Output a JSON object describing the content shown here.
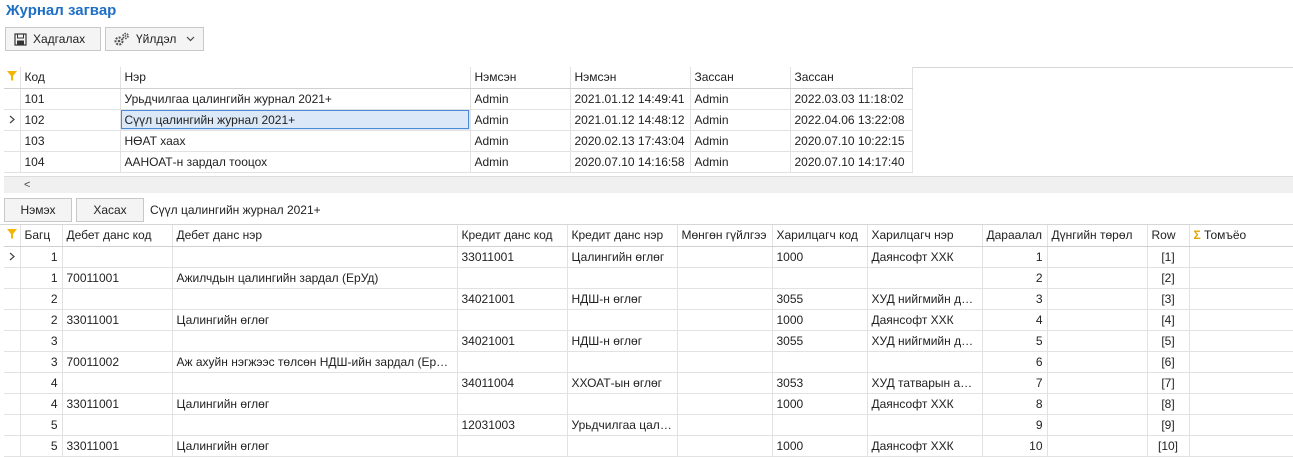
{
  "title": "Журнал загвар",
  "toolbar": {
    "save_label": "Хадгалах",
    "action_label": "Үйлдэл"
  },
  "master": {
    "columns": [
      "Код",
      "Нэр",
      "Нэмсэн",
      "Нэмсэн",
      "Зассан",
      "Зассан"
    ],
    "rows": [
      [
        "101",
        "Урьдчилгаа цалингийн журнал 2021+",
        "Admin",
        "2021.01.12 14:49:41",
        "Admin",
        "2022.03.03 11:18:02"
      ],
      [
        "102",
        "Сүүл цалингийн журнал 2021+",
        "Admin",
        "2021.01.12 14:48:12",
        "Admin",
        "2022.04.06 13:22:08"
      ],
      [
        "103",
        "НӨАТ хаах",
        "Admin",
        "2020.02.13 17:43:04",
        "Admin",
        "2020.07.10 10:22:15"
      ],
      [
        "104",
        "ААНОАТ-н зардал тооцох",
        "Admin",
        "2020.07.10 14:16:58",
        "Admin",
        "2020.07.10 14:17:40"
      ]
    ],
    "scroll_left": "<"
  },
  "detail_bar": {
    "add_label": "Нэмэх",
    "remove_label": "Хасах",
    "current_name": "Сүүл цалингийн журнал 2021+"
  },
  "detail": {
    "columns": [
      "Багц",
      "Дебет данс код",
      "Дебет данс нэр",
      "Кредит данс код",
      "Кредит данс нэр",
      "Мөнгөн гүйлгээ",
      "Харилцагч код",
      "Харилцагч нэр",
      "Дараалал",
      "Дүнгийн төрөл",
      "Row",
      "Томъёо"
    ],
    "rows": [
      [
        "1",
        "",
        "",
        "33011001",
        "Цалингийн өглөг",
        "",
        "1000",
        "Даянсофт ХХК",
        "1",
        "",
        "[1]",
        ""
      ],
      [
        "1",
        "70011001",
        "Ажилчдын цалингийн зардал (ЕрУд)",
        "",
        "",
        "",
        "",
        "",
        "2",
        "",
        "[2]",
        ""
      ],
      [
        "2",
        "",
        "",
        "34021001",
        "НДШ-н өглөг",
        "",
        "3055",
        "ХУД нийгмийн да...",
        "3",
        "",
        "[3]",
        ""
      ],
      [
        "2",
        "33011001",
        "Цалингийн өглөг",
        "",
        "",
        "",
        "1000",
        "Даянсофт ХХК",
        "4",
        "",
        "[4]",
        ""
      ],
      [
        "3",
        "",
        "",
        "34021001",
        "НДШ-н өглөг",
        "",
        "3055",
        "ХУД нийгмийн да...",
        "5",
        "",
        "[5]",
        ""
      ],
      [
        "3",
        "70011002",
        "Аж ахуйн нэгжээс төлсөн НДШ-ийн зардал (ЕрУд)",
        "",
        "",
        "",
        "",
        "",
        "6",
        "",
        "[6]",
        ""
      ],
      [
        "4",
        "",
        "",
        "34011004",
        "ХХОАТ-ын өглөг",
        "",
        "3053",
        "ХУД татварын алба",
        "7",
        "",
        "[7]",
        ""
      ],
      [
        "4",
        "33011001",
        "Цалингийн өглөг",
        "",
        "",
        "",
        "1000",
        "Даянсофт ХХК",
        "8",
        "",
        "[8]",
        ""
      ],
      [
        "5",
        "",
        "",
        "12031003",
        "Урьдчилгаа цалин",
        "",
        "",
        "",
        "9",
        "",
        "[9]",
        ""
      ],
      [
        "5",
        "33011001",
        "Цалингийн өглөг",
        "",
        "",
        "",
        "1000",
        "Даянсофт ХХК",
        "10",
        "",
        "[10]",
        ""
      ]
    ]
  },
  "colors": {
    "title": "#1e6fc4",
    "filter": "#f2b705",
    "selection": "#dbe8f7",
    "selection_border": "#4a89d6"
  }
}
